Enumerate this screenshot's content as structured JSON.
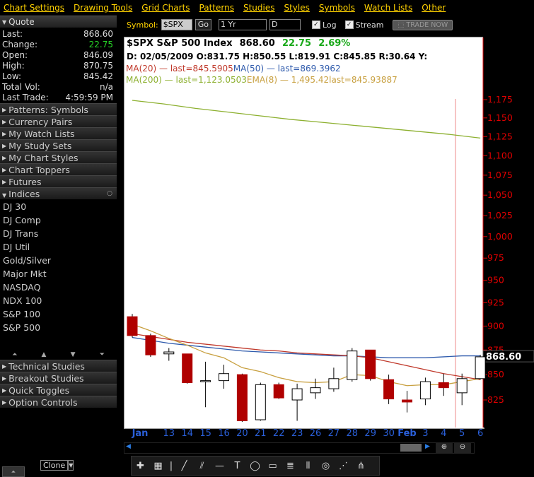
{
  "menu": [
    "Chart Settings",
    "Drawing Tools",
    "Grid Charts",
    "Patterns",
    "Studies",
    "Styles",
    "Symbols",
    "Watch Lists",
    "Other"
  ],
  "quote": {
    "header": "Quote",
    "rows": [
      {
        "label": "Last:",
        "value": "868.60"
      },
      {
        "label": "Change:",
        "value": "22.75"
      },
      {
        "label": "Open:",
        "value": "846.09"
      },
      {
        "label": "High:",
        "value": "870.75"
      },
      {
        "label": "Low:",
        "value": "845.42"
      },
      {
        "label": "Total Vol:",
        "value": "n/a"
      },
      {
        "label": "Last Trade:",
        "value": "4:59:59 PM"
      }
    ]
  },
  "sections_top": [
    "Patterns: Symbols",
    "Currency Pairs",
    "My Watch Lists",
    "My Study Sets",
    "My Chart Styles",
    "Chart Toppers",
    "Futures"
  ],
  "indices": {
    "header": "Indices",
    "items": [
      "DJ 30",
      "DJ Comp",
      "DJ Trans",
      "DJ Util",
      "Gold/Silver",
      "Major Mkt",
      "NASDAQ",
      "NDX 100",
      "S&P 100",
      "S&P 500"
    ]
  },
  "sections_bottom": [
    "Technical Studies",
    "Breakout Studies",
    "Quick Toggles",
    "Option Controls"
  ],
  "toolbar": {
    "symbol_label": "Symbol:",
    "symbol_value": "$SPX",
    "go": "Go",
    "range": "1 Yr",
    "interval": "D",
    "log": "Log",
    "stream": "Stream",
    "trade": "TRADE NOW"
  },
  "clone": "Clone",
  "colors": {
    "up": "#27d827",
    "candle_down": "#b00000",
    "ma20": "#c0392b",
    "ma50": "#2e5aac",
    "ma200": "#8db030",
    "ema8": "#c8a040",
    "axis": "#e00000"
  },
  "chart_data": {
    "type": "candlestick",
    "title": "$SPX S&P 500 Index",
    "last_header": "868.60",
    "change_header": "22.75",
    "pct_header": "2.69%",
    "ohlc_line": "D: 02/05/2009 O:831.75 H:850.55 L:819.91 C:845.85 R:30.64 Y:",
    "legend": [
      {
        "name": "MA(20)",
        "text": "last=845.5905",
        "color": "#c0392b"
      },
      {
        "name": "MA(50)",
        "text": "last=869.3962",
        "color": "#2e5aac"
      },
      {
        "name": "MA(200)",
        "text": "last=1,123.0503",
        "color": "#8db030"
      },
      {
        "name": "EMA(8)",
        "text": "1,495.42last=845.93887",
        "color": "#c8a040"
      }
    ],
    "y_ticks": [
      "1,175",
      "1,150",
      "1,125",
      "1,100",
      "1,075",
      "1,050",
      "1,025",
      "1,000",
      "975",
      "950",
      "925",
      "900",
      "875",
      "850",
      "825"
    ],
    "y_tick_values": [
      1175,
      1150,
      1125,
      1100,
      1075,
      1050,
      1025,
      1000,
      975,
      950,
      925,
      900,
      875,
      850,
      825
    ],
    "last_price_label": "868.60",
    "x_labels": [
      "Jan",
      "13",
      "14",
      "15",
      "16",
      "20",
      "21",
      "22",
      "23",
      "26",
      "27",
      "28",
      "29",
      "30",
      "Feb",
      "3",
      "4",
      "5",
      "6"
    ],
    "candles": [
      {
        "o": 910,
        "h": 913,
        "l": 888,
        "c": 890
      },
      {
        "o": 890,
        "h": 892,
        "l": 868,
        "c": 870
      },
      {
        "o": 871,
        "h": 877,
        "l": 864,
        "c": 873
      },
      {
        "o": 871,
        "h": 871,
        "l": 841,
        "c": 842
      },
      {
        "o": 843,
        "h": 863,
        "l": 818,
        "c": 844
      },
      {
        "o": 844,
        "h": 860,
        "l": 836,
        "c": 851
      },
      {
        "o": 850,
        "h": 851,
        "l": 804,
        "c": 805
      },
      {
        "o": 806,
        "h": 842,
        "l": 805,
        "c": 840
      },
      {
        "o": 840,
        "h": 842,
        "l": 826,
        "c": 827
      },
      {
        "o": 825,
        "h": 841,
        "l": 805,
        "c": 836
      },
      {
        "o": 832,
        "h": 846,
        "l": 826,
        "c": 837
      },
      {
        "o": 836,
        "h": 857,
        "l": 833,
        "c": 846
      },
      {
        "o": 845,
        "h": 877,
        "l": 843,
        "c": 874
      },
      {
        "o": 875,
        "h": 875,
        "l": 844,
        "c": 846
      },
      {
        "o": 845,
        "h": 850,
        "l": 821,
        "c": 826
      },
      {
        "o": 825,
        "h": 834,
        "l": 813,
        "c": 823
      },
      {
        "o": 826,
        "h": 847,
        "l": 820,
        "c": 843
      },
      {
        "o": 842,
        "h": 851,
        "l": 829,
        "c": 837
      },
      {
        "o": 832,
        "h": 851,
        "l": 820,
        "c": 846
      },
      {
        "o": 846,
        "h": 870,
        "l": 845,
        "c": 868
      }
    ],
    "ma200": [
      1174,
      1169,
      1163,
      1158,
      1153,
      1148,
      1144,
      1140,
      1136,
      1132,
      1128,
      1123
    ],
    "ma50": [
      888,
      885,
      882,
      880,
      878,
      876,
      874,
      873,
      872,
      871,
      870,
      869,
      869,
      868,
      867,
      867,
      867,
      868,
      869,
      869
    ],
    "ma20": [
      892,
      889,
      886,
      883,
      881,
      879,
      877,
      875,
      874,
      872,
      871,
      870,
      869,
      867,
      863,
      859,
      855,
      851,
      848,
      845
    ],
    "ema8": [
      902,
      895,
      887,
      880,
      872,
      867,
      857,
      853,
      847,
      843,
      842,
      843,
      850,
      849,
      843,
      839,
      840,
      840,
      843,
      846
    ]
  }
}
